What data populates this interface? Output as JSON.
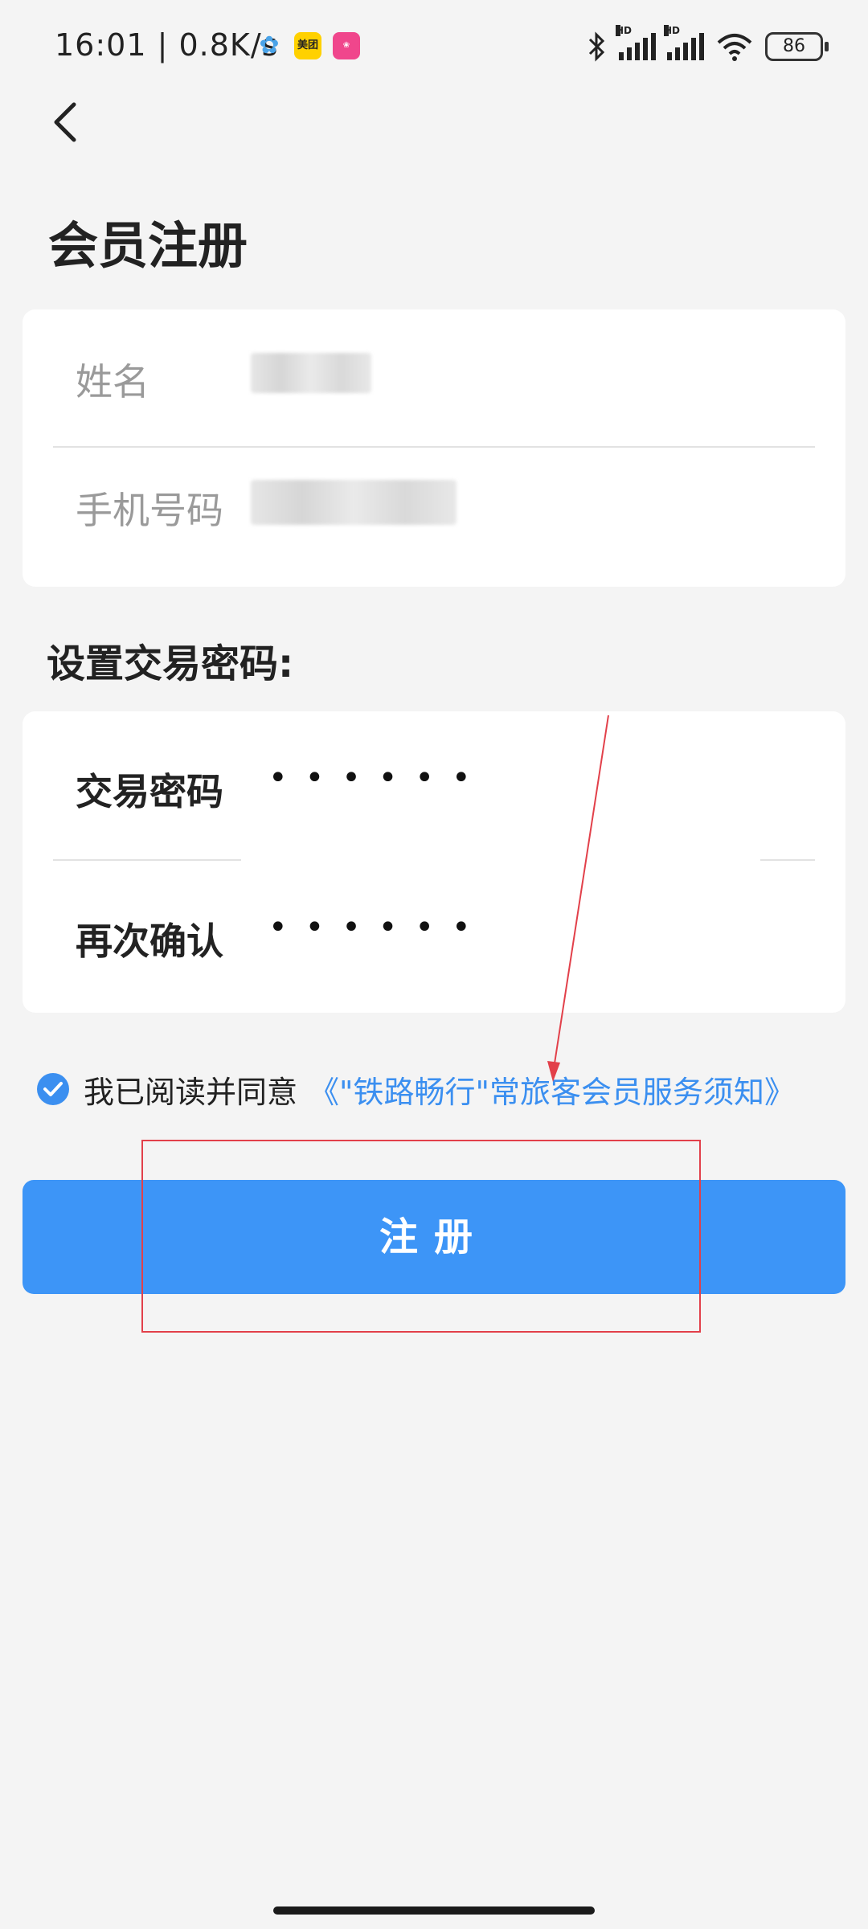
{
  "status_bar": {
    "time_speed": "16:01 | 0.8K/s",
    "meituan_icon": "美团",
    "battery": "86",
    "hd_label": "HD"
  },
  "header": {
    "title": "会员注册"
  },
  "form": {
    "name_label": "姓名",
    "phone_label": "手机号码"
  },
  "password_section": {
    "title": "设置交易密码:",
    "password_label": "交易密码",
    "password_value": "••••••",
    "confirm_label": "再次确认",
    "confirm_value": "••••••"
  },
  "agreement": {
    "checked": true,
    "text": "我已阅读并同意",
    "link": "《\"铁路畅行\"常旅客会员服务须知》"
  },
  "register_button": {
    "label": "注册"
  },
  "colors": {
    "accent": "#3d95f7",
    "link": "#3b8ff0",
    "annotation": "#e2404a",
    "background": "#f4f4f4"
  }
}
